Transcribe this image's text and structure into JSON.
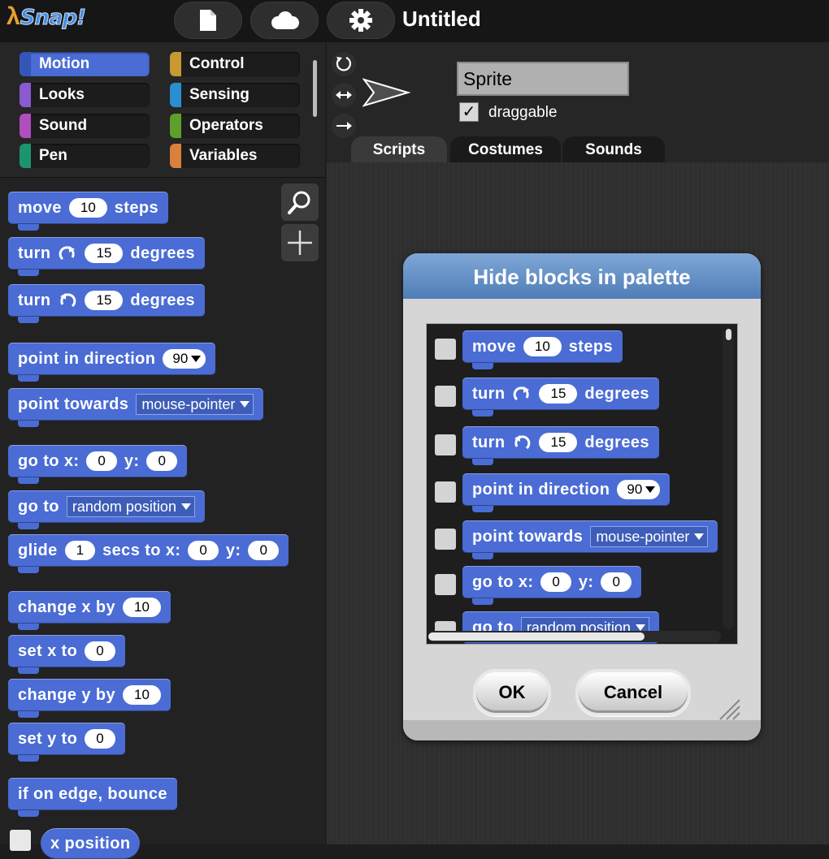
{
  "app": {
    "logo_lambda": "λ",
    "logo_text": "Snap!",
    "title": "Untitled",
    "buttons": [
      {
        "name": "file-button",
        "icon": "file-icon"
      },
      {
        "name": "cloud-button",
        "icon": "cloud-icon"
      },
      {
        "name": "settings-button",
        "icon": "gear-icon"
      }
    ]
  },
  "categories": [
    {
      "label": "Motion",
      "color": "#4a6cd4",
      "selected": true
    },
    {
      "label": "Control",
      "color": "#e6a822"
    },
    {
      "label": "Looks",
      "color": "#8f56e3"
    },
    {
      "label": "Sensing",
      "color": "#0494dc"
    },
    {
      "label": "Sound",
      "color": "#cf4ad9"
    },
    {
      "label": "Operators",
      "color": "#62c213"
    },
    {
      "label": "Pen",
      "color": "#00a178"
    },
    {
      "label": "Variables",
      "color": "#f3761d"
    }
  ],
  "palette": {
    "move": {
      "a": "move",
      "v": "10",
      "b": "steps"
    },
    "turn_cw": {
      "a": "turn",
      "v": "15",
      "b": "degrees"
    },
    "turn_ccw": {
      "a": "turn",
      "v": "15",
      "b": "degrees"
    },
    "point_dir": {
      "a": "point in direction",
      "v": "90"
    },
    "point_towards": {
      "a": "point towards",
      "v": "mouse-pointer"
    },
    "goto_xy": {
      "a": "go to x:",
      "x": "0",
      "b": "y:",
      "y": "0"
    },
    "goto": {
      "a": "go to",
      "v": "random position"
    },
    "glide": {
      "a": "glide",
      "v": "1",
      "b": "secs to x:",
      "x": "0",
      "c": "y:",
      "y": "0"
    },
    "change_x": {
      "a": "change x by",
      "v": "10"
    },
    "set_x": {
      "a": "set x to",
      "v": "0"
    },
    "change_y": {
      "a": "change y by",
      "v": "10"
    },
    "set_y": {
      "a": "set y to",
      "v": "0"
    },
    "bounce": {
      "a": "if on edge, bounce"
    },
    "x_position": {
      "a": "x position"
    }
  },
  "sprite": {
    "name": "Sprite",
    "draggable_label": "draggable",
    "draggable_check": "✓"
  },
  "tabs": [
    "Scripts",
    "Costumes",
    "Sounds"
  ],
  "dialog": {
    "title": "Hide blocks in palette",
    "ok": "OK",
    "cancel": "Cancel"
  }
}
